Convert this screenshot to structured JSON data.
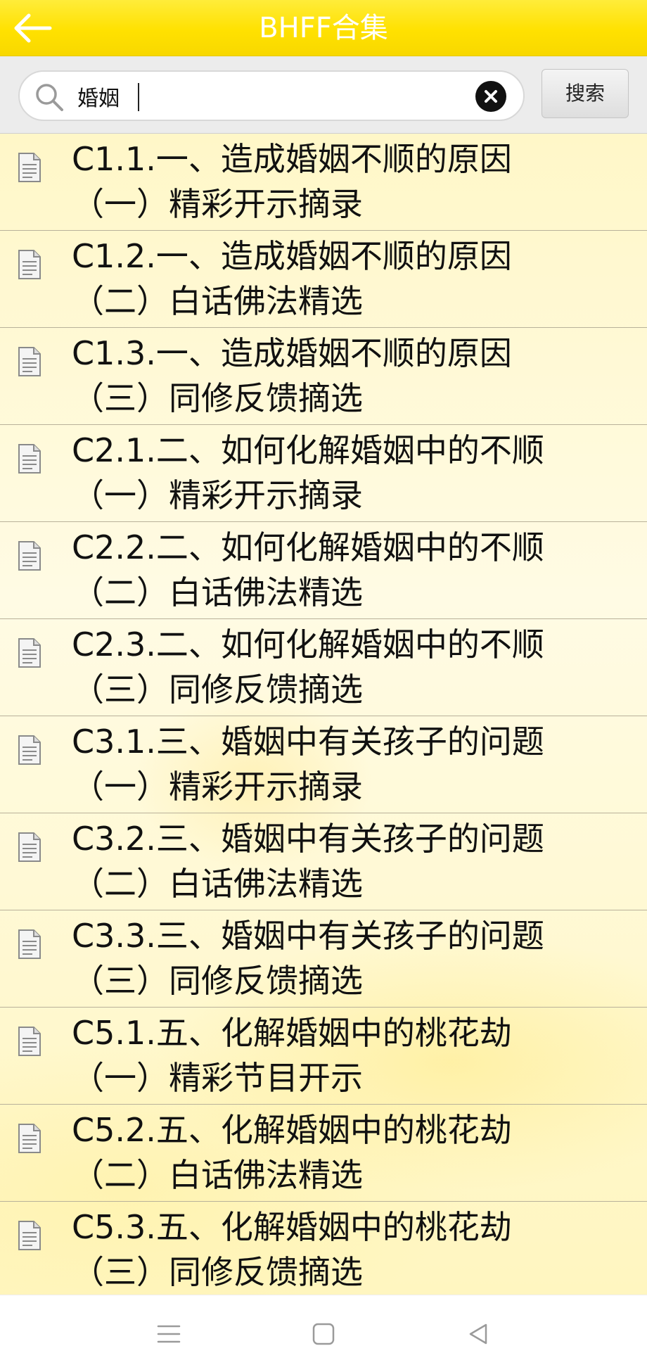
{
  "header": {
    "title": "BHFF合集",
    "back_icon": "arrow-left-icon"
  },
  "search": {
    "value": "婚姻",
    "placeholder": "",
    "button_label": "搜索",
    "icons": {
      "search": "search-icon",
      "clear": "clear-icon"
    }
  },
  "colors": {
    "header_bg": "#ffe100",
    "header_text": "#ffffff",
    "list_bg": "#fff7c8",
    "divider": "#b8b19a"
  },
  "results": [
    {
      "line1": "C1.1.一、造成婚姻不顺的原因",
      "line2": "（一）精彩开示摘录"
    },
    {
      "line1": "C1.2.一、造成婚姻不顺的原因",
      "line2": "（二）白话佛法精选"
    },
    {
      "line1": "C1.3.一、造成婚姻不顺的原因",
      "line2": "（三）同修反馈摘选"
    },
    {
      "line1": "C2.1.二、如何化解婚姻中的不顺",
      "line2": "（一）精彩开示摘录"
    },
    {
      "line1": "C2.2.二、如何化解婚姻中的不顺",
      "line2": "（二）白话佛法精选"
    },
    {
      "line1": "C2.3.二、如何化解婚姻中的不顺",
      "line2": "（三）同修反馈摘选"
    },
    {
      "line1": "C3.1.三、婚姻中有关孩子的问题",
      "line2": "（一）精彩开示摘录"
    },
    {
      "line1": "C3.2.三、婚姻中有关孩子的问题",
      "line2": "（二）白话佛法精选"
    },
    {
      "line1": "C3.3.三、婚姻中有关孩子的问题",
      "line2": "（三）同修反馈摘选"
    },
    {
      "line1": "C5.1.五、化解婚姻中的桃花劫",
      "line2": "（一）精彩节目开示"
    },
    {
      "line1": "C5.2.五、化解婚姻中的桃花劫",
      "line2": "（二）白话佛法精选"
    },
    {
      "line1": "C5.3.五、化解婚姻中的桃花劫",
      "line2": "（三）同修反馈摘选"
    }
  ],
  "navbar": {
    "icons": [
      "menu-icon",
      "home-icon",
      "back-icon"
    ]
  }
}
